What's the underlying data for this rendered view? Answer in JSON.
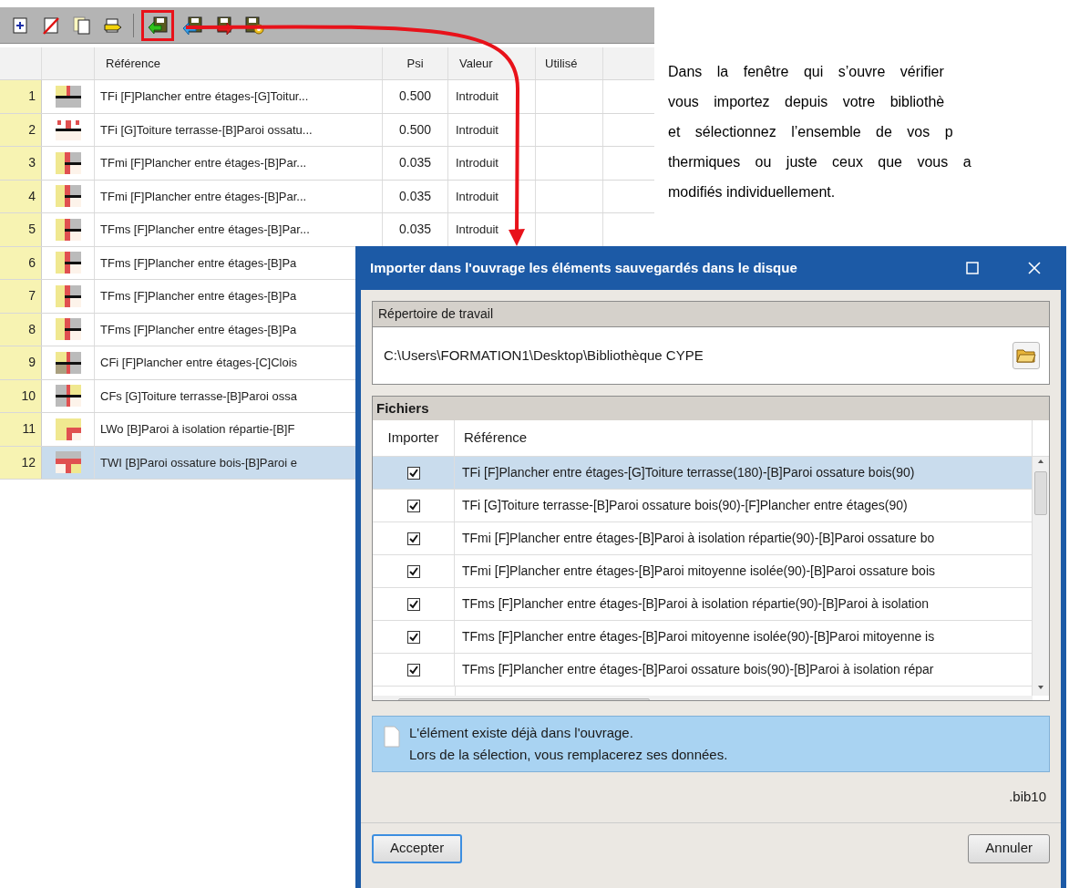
{
  "toolbar": [
    {
      "highlighted": false
    },
    {
      "highlighted": false
    },
    {
      "highlighted": false
    },
    {
      "highlighted": false
    },
    {
      "highlighted": true
    },
    {
      "highlighted": false
    },
    {
      "highlighted": false
    },
    {
      "highlighted": false
    }
  ],
  "table": {
    "columns": [
      "Référence",
      "Psi",
      "Valeur",
      "Utilisé"
    ],
    "rows": [
      {
        "number": "1",
        "reference": "TFi [F]Plancher entre étages-[G]Toitur...",
        "psi": "0.500",
        "value": "Introduit",
        "selected": false
      },
      {
        "number": "2",
        "reference": "TFi [G]Toiture terrasse-[B]Paroi ossatu...",
        "psi": "0.500",
        "value": "Introduit",
        "selected": false
      },
      {
        "number": "3",
        "reference": "TFmi [F]Plancher entre étages-[B]Par...",
        "psi": "0.035",
        "value": "Introduit",
        "selected": false
      },
      {
        "number": "4",
        "reference": "TFmi [F]Plancher entre étages-[B]Par...",
        "psi": "0.035",
        "value": "Introduit",
        "selected": false
      },
      {
        "number": "5",
        "reference": "TFms [F]Plancher entre étages-[B]Par...",
        "psi": "0.035",
        "value": "Introduit",
        "selected": false
      },
      {
        "number": "6",
        "reference": "TFms [F]Plancher entre étages-[B]Pa",
        "selected": false
      },
      {
        "number": "7",
        "reference": "TFms [F]Plancher entre étages-[B]Pa",
        "selected": false
      },
      {
        "number": "8",
        "reference": "TFms [F]Plancher entre étages-[B]Pa",
        "selected": false
      },
      {
        "number": "9",
        "reference": "CFi [F]Plancher entre étages-[C]Clois",
        "selected": false
      },
      {
        "number": "10",
        "reference": "CFs [G]Toiture terrasse-[B]Paroi ossa",
        "selected": false
      },
      {
        "number": "11",
        "reference": "LWo [B]Paroi à isolation répartie-[B]F",
        "selected": false
      },
      {
        "number": "12",
        "reference": "TWI [B]Paroi ossature bois-[B]Paroi e",
        "selected": true
      }
    ]
  },
  "paragraph": {
    "lines": [
      "Dans la fenêtre qui s’ouvre vérifier",
      "vous importez depuis votre bibliothè",
      "et sélectionnez l’ensemble de vos p",
      "thermiques ou juste ceux que vous a",
      "modifiés individuellement."
    ]
  },
  "dialog": {
    "title": "Importer dans l'ouvrage les éléments sauvegardés dans le disque",
    "working_directory": {
      "label": "Répertoire de travail",
      "path": "C:\\Users\\FORMATION1\\Desktop\\Bibliothèque CYPE"
    },
    "files": {
      "label": "Fichiers",
      "columns": [
        "Importer",
        "Référence"
      ],
      "rows": [
        {
          "checked": true,
          "selected": true,
          "reference": "TFi [F]Plancher entre étages-[G]Toiture terrasse(180)-[B]Paroi ossature bois(90)"
        },
        {
          "checked": true,
          "selected": false,
          "reference": "TFi [G]Toiture terrasse-[B]Paroi ossature bois(90)-[F]Plancher entre étages(90)"
        },
        {
          "checked": true,
          "selected": false,
          "reference": "TFmi [F]Plancher entre étages-[B]Paroi à isolation répartie(90)-[B]Paroi ossature bo"
        },
        {
          "checked": true,
          "selected": false,
          "reference": "TFmi [F]Plancher entre étages-[B]Paroi mitoyenne isolée(90)-[B]Paroi ossature bois"
        },
        {
          "checked": true,
          "selected": false,
          "reference": "TFms [F]Plancher entre étages-[B]Paroi à isolation répartie(90)-[B]Paroi à isolation"
        },
        {
          "checked": true,
          "selected": false,
          "reference": "TFms [F]Plancher entre étages-[B]Paroi mitoyenne isolée(90)-[B]Paroi mitoyenne is"
        },
        {
          "checked": true,
          "selected": false,
          "reference": "TFms [F]Plancher entre étages-[B]Paroi ossature bois(90)-[B]Paroi à isolation répar"
        }
      ]
    },
    "info": [
      "L'élément existe déjà dans l'ouvrage.",
      "Lors de la sélection, vous remplacerez ses données."
    ],
    "extension": ".bib10",
    "buttons": [
      {
        "label": "Accepter",
        "focused": true
      },
      {
        "label": "Annuler",
        "focused": false
      }
    ]
  }
}
